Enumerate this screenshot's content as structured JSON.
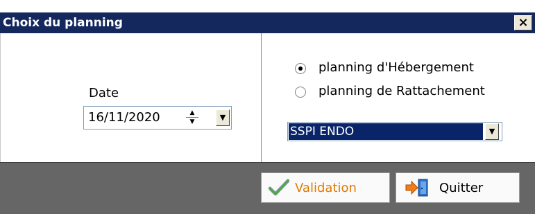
{
  "window": {
    "title": "Choix du planning",
    "close_label": "×"
  },
  "date": {
    "label": "Date",
    "value": "16/11/2020"
  },
  "planning_type": {
    "options": [
      {
        "label": "planning d'Hébergement",
        "selected": true
      },
      {
        "label": "planning de Rattachement",
        "selected": false
      }
    ]
  },
  "unit_select": {
    "value": "SSPI ENDO"
  },
  "buttons": {
    "validate_label": "Validation",
    "quit_label": "Quitter"
  },
  "colors": {
    "titlebar": "#14285e",
    "validate_text": "#e07b00",
    "footer": "#666666",
    "selection": "#0a246a"
  },
  "icons": {
    "validate": "checkmark-icon",
    "quit": "exit-door-icon",
    "close": "close-icon",
    "spin": "spinner-arrows-icon",
    "dropdown": "chevron-down-icon"
  }
}
